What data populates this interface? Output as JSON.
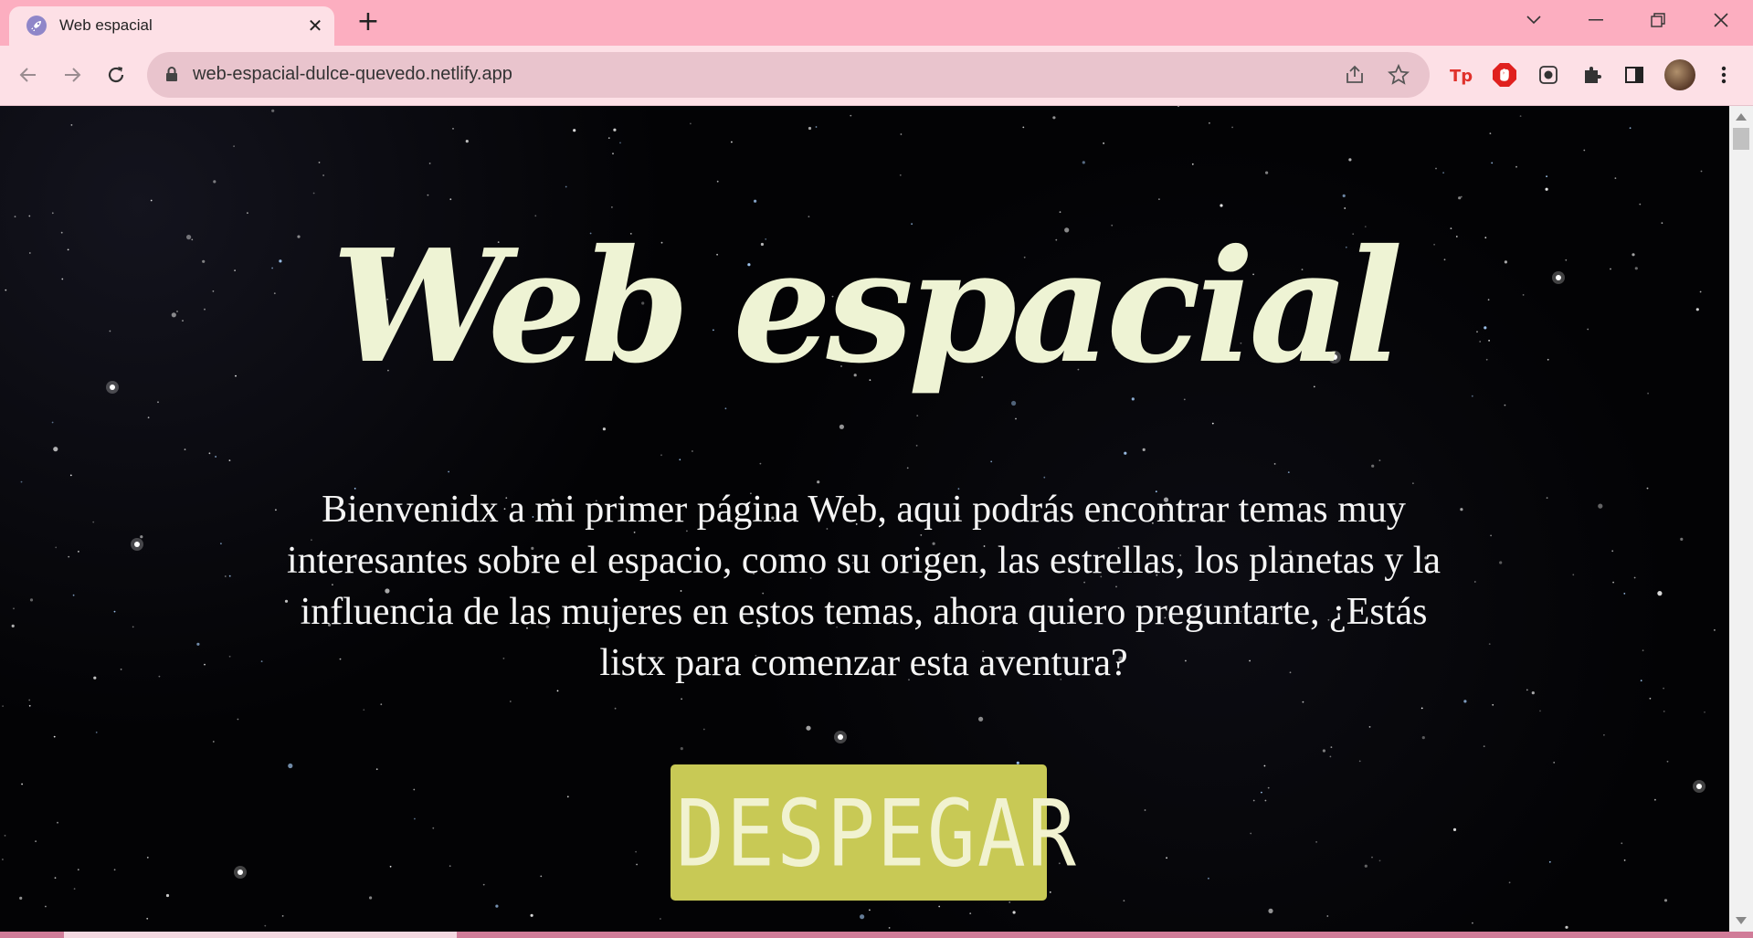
{
  "browser": {
    "tab": {
      "title": "Web espacial",
      "favicon": "rocket-icon"
    },
    "new_tab_icon": "plus-icon",
    "window_controls": [
      "chevron-down-icon",
      "minimize-icon",
      "restore-icon",
      "close-icon"
    ],
    "omnibox": {
      "url": "web-espacial-dulce-quevedo.netlify.app"
    },
    "extensions": [
      "tp-extension-icon",
      "adblock-icon",
      "record-icon",
      "puzzle-icon",
      "side-panel-icon"
    ],
    "colors": {
      "frame": "#fcaec0",
      "toolbar": "#fde0e6",
      "omnibox": "#e9c4cd"
    }
  },
  "page": {
    "title": "Web espacial",
    "intro": "Bienvenidx a mi primer página Web, aqui podrás encontrar temas muy interesantes sobre el espacio, como su origen, las estrellas, los planetas y la influencia de las mujeres en estos temas, ahora quiero preguntarte, ¿Estás listx para comenzar esta aventura?",
    "launch_button": "DESPEGAR",
    "colors": {
      "title": "#eef3d4",
      "button_bg": "#c8c955",
      "button_text": "#f1f2d0",
      "background": "#030305"
    }
  }
}
